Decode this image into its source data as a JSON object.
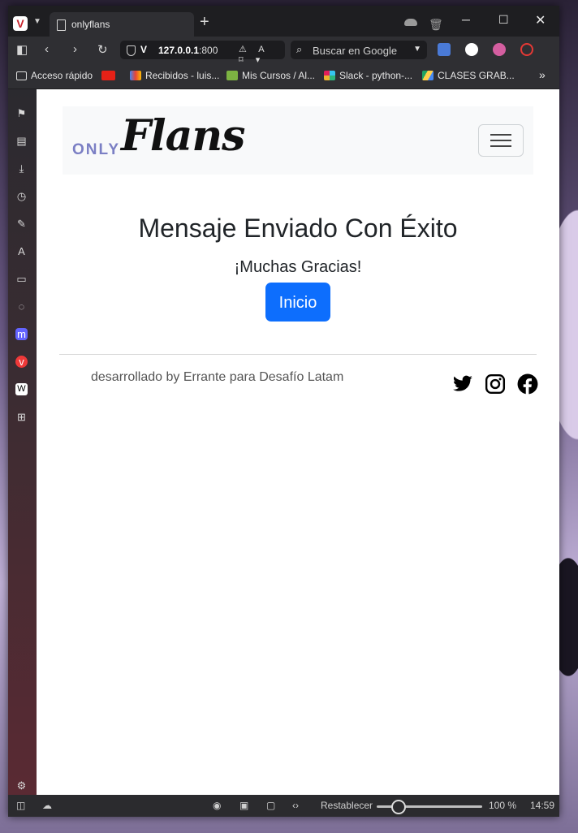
{
  "tab": {
    "title": "onlyflans"
  },
  "address": {
    "host": "127.0.0.1",
    "port": ":800"
  },
  "search": {
    "placeholder": "Buscar en Google"
  },
  "bookmarks": [
    {
      "label": "Acceso rápido",
      "icon": "folder-icon"
    },
    {
      "label": "",
      "icon": "youtube-icon"
    },
    {
      "label": "Recibidos - luis...",
      "icon": "gmail-icon"
    },
    {
      "label": "Mis Cursos / Al...",
      "icon": "course-icon"
    },
    {
      "label": "Slack - python-...",
      "icon": "slack-icon"
    },
    {
      "label": "CLASES GRAB...",
      "icon": "drive-icon"
    }
  ],
  "site": {
    "logo": {
      "small": "ONLY",
      "script": "Flans"
    },
    "heading": "Mensaje Enviado Con Éxito",
    "subheading": "¡Muchas Gracias!",
    "button_label": "Inicio",
    "footer_text": "desarrollado by Errante para Desafío Latam",
    "social": [
      "twitter-icon",
      "instagram-icon",
      "facebook-icon"
    ]
  },
  "status": {
    "reset_label": "Restablecer",
    "zoom": "100 %",
    "clock": "14:59"
  },
  "colors": {
    "primary_button": "#0d6efd",
    "logo_accent": "#7b7fc4",
    "navbar_bg": "#f8f9fa"
  }
}
